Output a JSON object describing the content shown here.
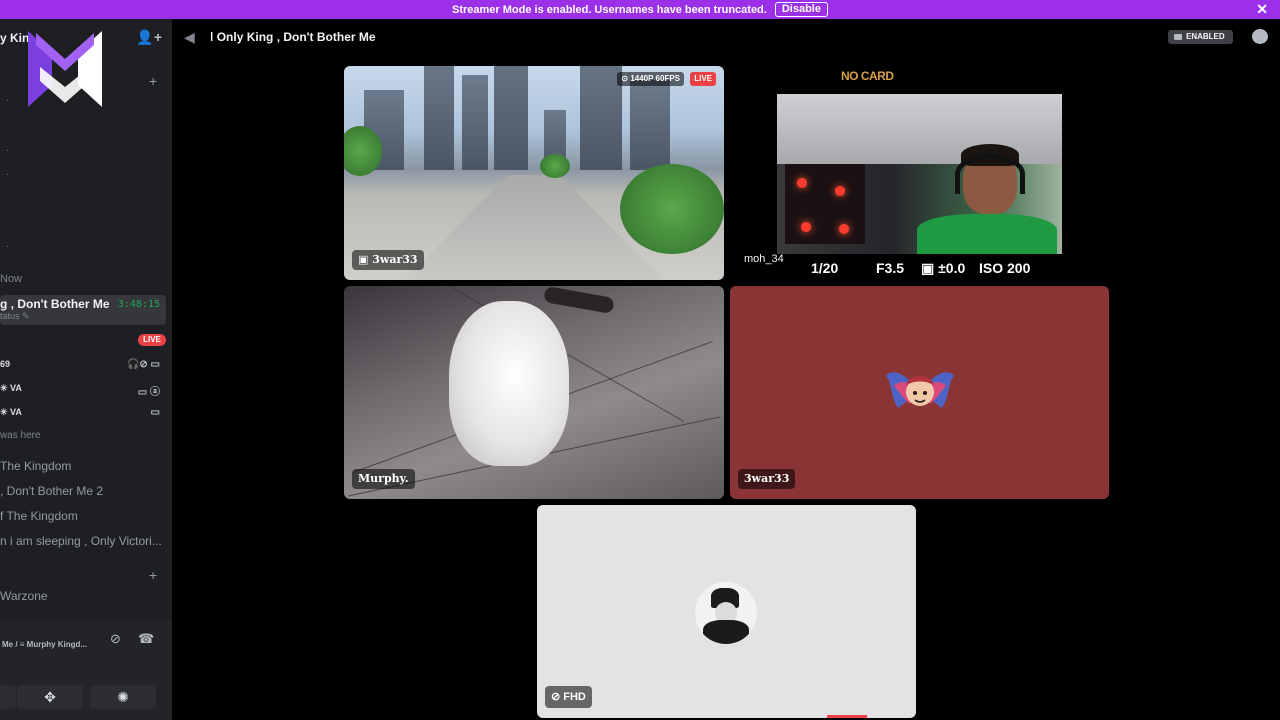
{
  "banner": {
    "text": "Streamer Mode is enabled. Usernames have been truncated.",
    "disable_label": "Disable",
    "close_glyph": "✕"
  },
  "sidebar": {
    "server_name": "y Kin",
    "invite_glyph": "👤+",
    "plus_glyph": "+",
    "category_now": "Now",
    "active_channel": {
      "name": "g , Don't Bother Me",
      "time": "3:48:15",
      "status": "tatus ✎"
    },
    "live_label": "LIVE",
    "voice_users": [
      {
        "name": "69",
        "icons": "🎧⊘ ▭"
      },
      {
        "name": "✳ VA",
        "icons": "▭ ⓐ"
      },
      {
        "name": "✳ VA",
        "icons": "▭"
      }
    ],
    "was_here": "was here",
    "channels": [
      "The Kingdom",
      ", Don't Bother Me 2",
      "f The Kingdom",
      "n i am sleeping , Only Victori..."
    ],
    "category_warzone": "Warzone",
    "voice_panel": {
      "connection": "Me / ≡ Murphy Kingd...",
      "mute_glyph": "⊘",
      "hangup_glyph": "☎",
      "activity_glyph": "✥",
      "soundboard_glyph": "✺"
    }
  },
  "topbar": {
    "speaker_glyph": "◀",
    "title": "ǀ Only King , Don't Bother Me",
    "enabled_label": "ENABLED"
  },
  "tiles": {
    "gta": {
      "label": "▣ 3war33",
      "quality": "⊙ 1440P 60FPS",
      "live": "LIVE"
    },
    "cam": {
      "no_card": "NO CARD",
      "name": "moh_34",
      "shutter": "1/20",
      "aperture": "F3.5",
      "exposure": "▣ ±0.0",
      "iso": "ISO 200"
    },
    "dog": {
      "label": "Murphy."
    },
    "avatar": {
      "label": "3war33"
    },
    "fhd": {
      "label": "⊘ FHD"
    }
  },
  "colors": {
    "banner": "#9b30e8",
    "sidebar": "#1e1f22",
    "live": "#ed4245",
    "timer": "#23a55a",
    "avatar_tile": "#8a3436",
    "fhd_tile": "#e3e3e5"
  }
}
